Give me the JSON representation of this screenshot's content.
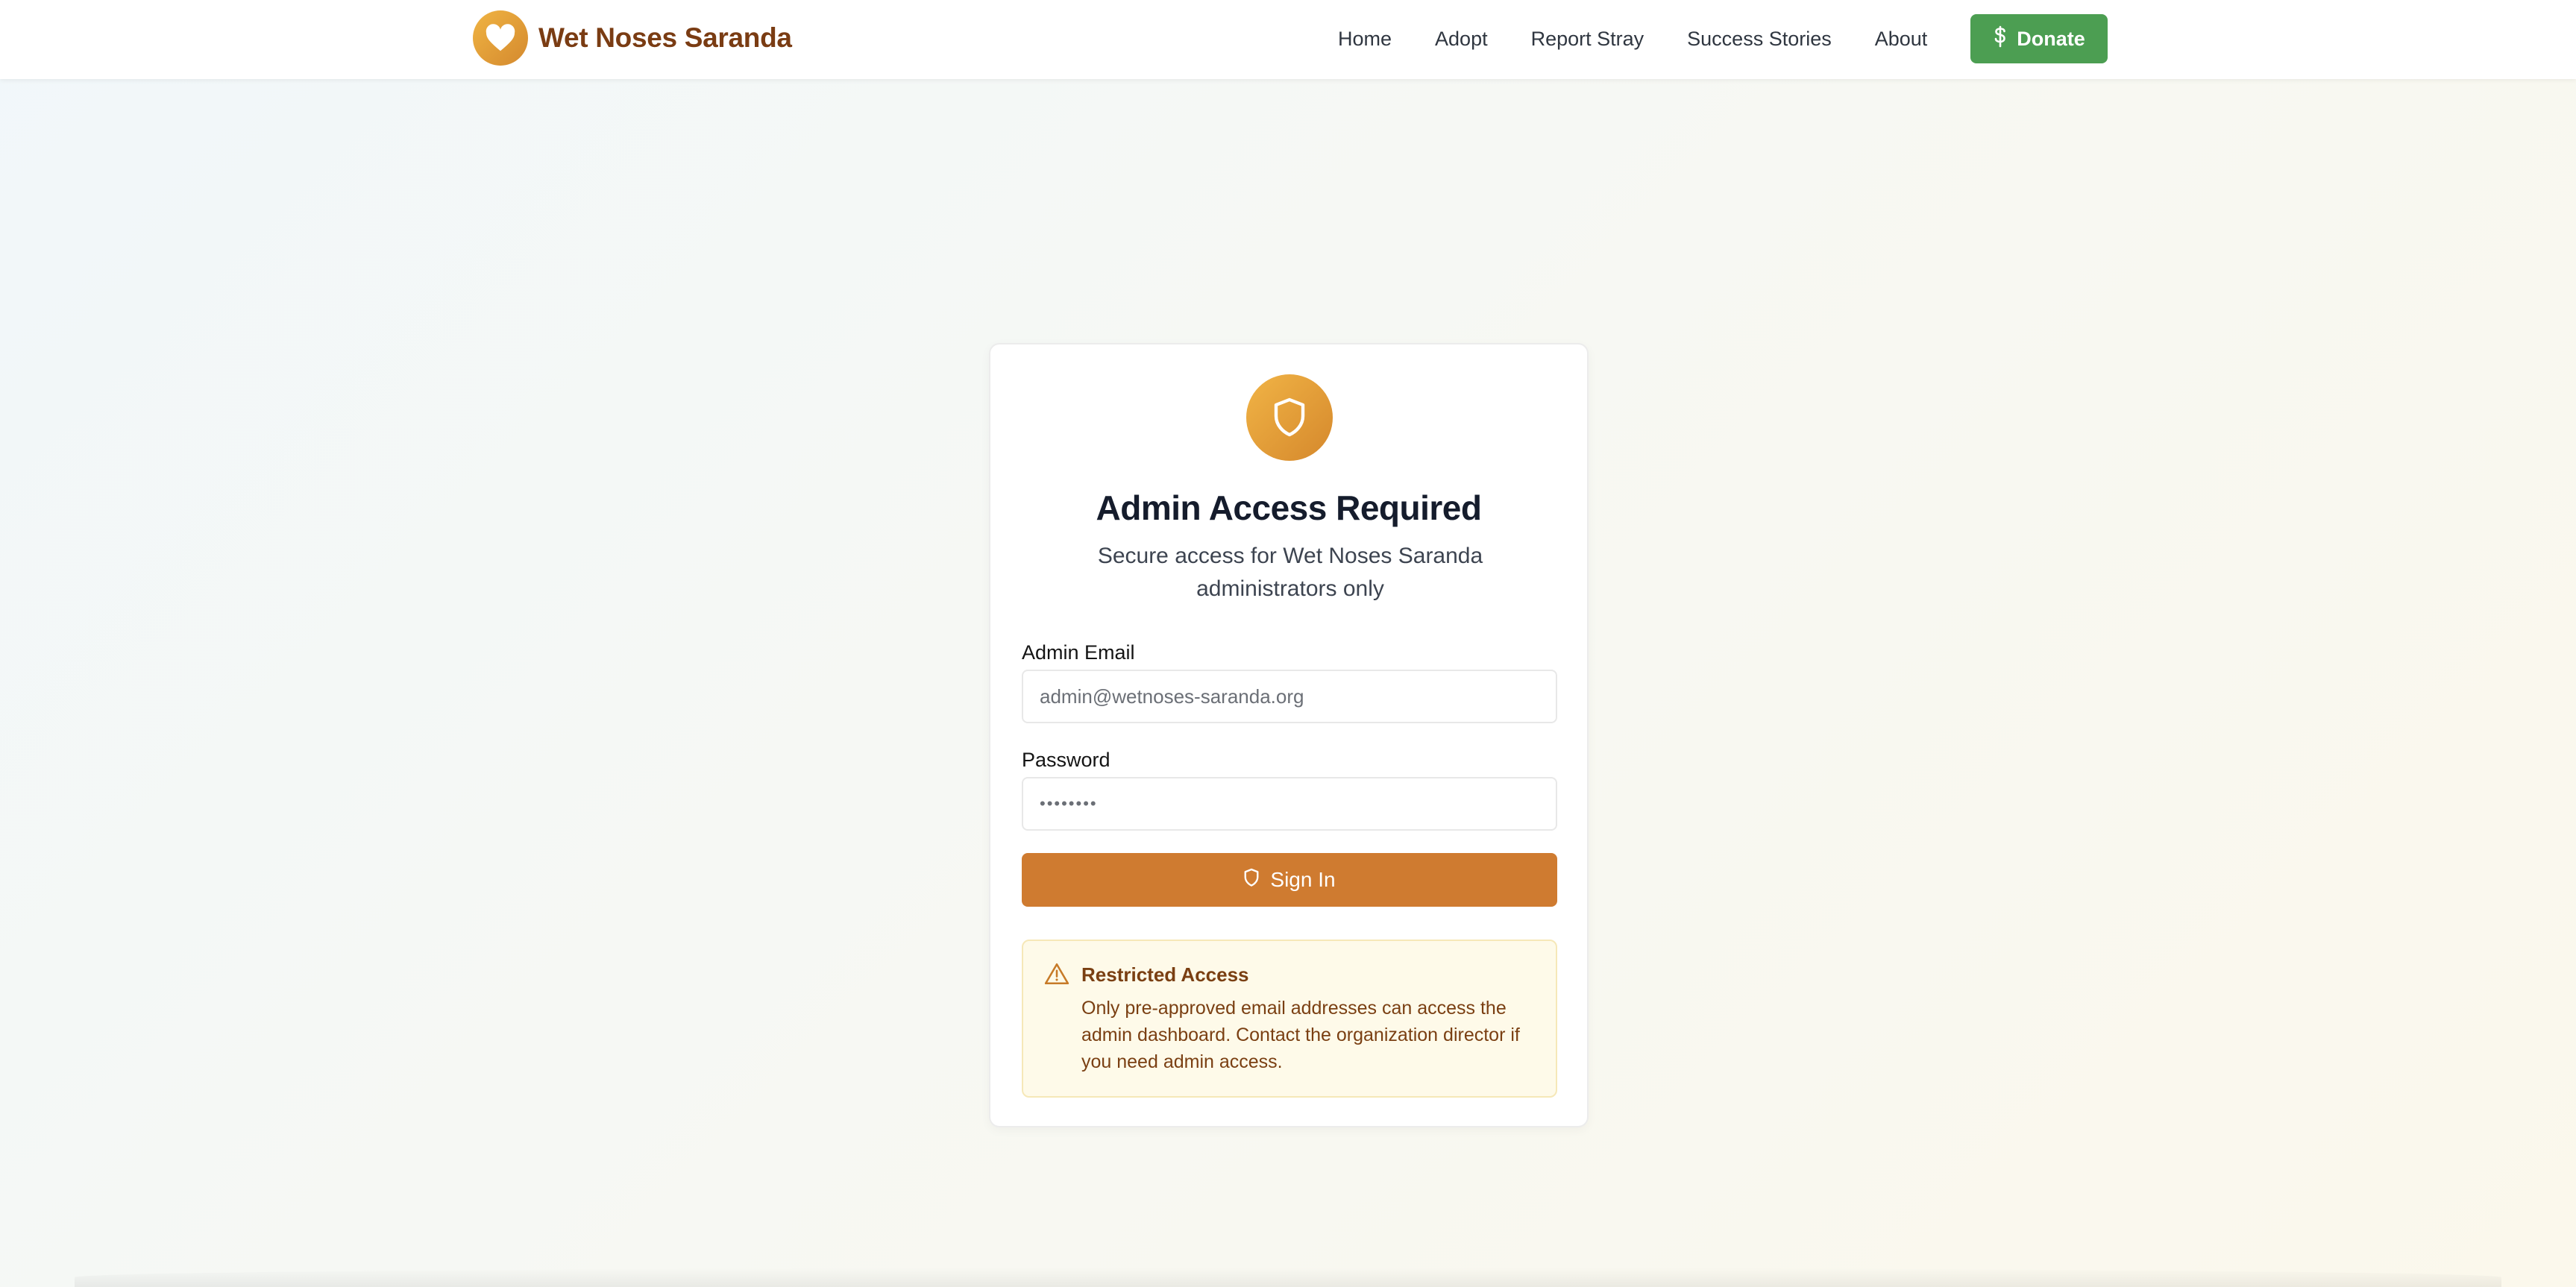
{
  "header": {
    "brand_name": "Wet Noses Saranda",
    "brand_icon": "heart-icon",
    "nav": [
      {
        "label": "Home"
      },
      {
        "label": "Adopt"
      },
      {
        "label": "Report Stray"
      },
      {
        "label": "Success Stories"
      },
      {
        "label": "About"
      }
    ],
    "donate_label": "Donate",
    "donate_icon": "dollar-icon",
    "donate_color": "#4c9e52"
  },
  "card": {
    "badge_icon": "shield-icon",
    "title": "Admin Access Required",
    "subtitle": "Secure access for Wet Noses Saranda administrators only",
    "email_label": "Admin Email",
    "email_placeholder": "admin@wetnoses-saranda.org",
    "password_label": "Password",
    "password_value": "••••••••",
    "signin_label": "Sign In",
    "signin_color": "#cf7b30",
    "notice": {
      "icon": "warning-icon",
      "title": "Restricted Access",
      "body": "Only pre-approved email addresses can access the admin dashboard. Contact the organization director if you need admin access."
    }
  },
  "colors": {
    "brand": "#7a3c13",
    "accent_gold": "#e3a03a"
  }
}
